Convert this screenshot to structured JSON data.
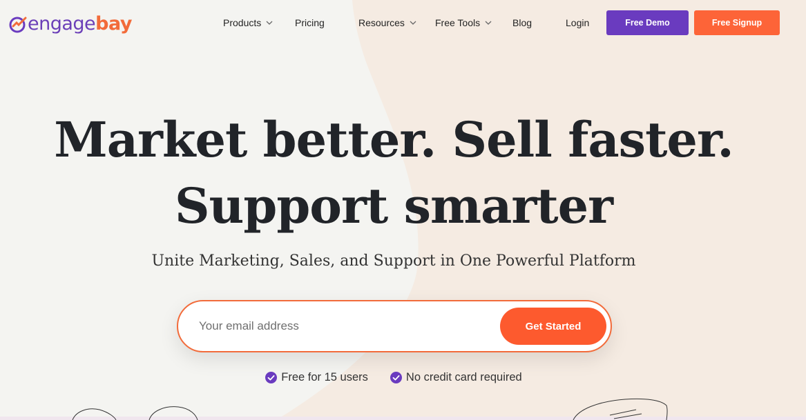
{
  "brand": {
    "name_part1": "engage",
    "name_part2": "bay",
    "logo_icon": "engagebay-logo-icon",
    "colors": {
      "purple": "#6a3bbf",
      "orange": "#fd6438"
    }
  },
  "nav": {
    "products": "Products",
    "pricing": "Pricing",
    "resources": "Resources",
    "free_tools": "Free Tools",
    "blog": "Blog",
    "login": "Login",
    "free_demo": "Free Demo",
    "free_signup": "Free Signup"
  },
  "hero": {
    "title_line1": "Market better. Sell faster.",
    "title_line2": "Support smarter",
    "subtitle": "Unite Marketing, Sales, and Support in One Powerful Platform"
  },
  "signup_form": {
    "email_placeholder": "Your email address",
    "cta_label": "Get Started"
  },
  "badges": {
    "free_users": "Free for 15 users",
    "no_card": "No credit card required",
    "icon": "check-circle-icon"
  }
}
